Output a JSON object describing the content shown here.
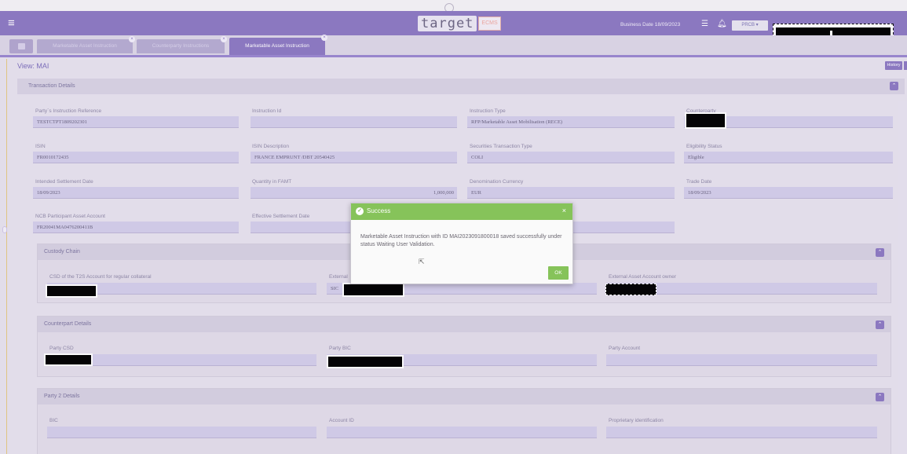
{
  "header": {
    "logo_text": "target",
    "logo_badge": "ECMS",
    "business_date": "Business Date 18/09/2023",
    "user_button": "PRCB ▾",
    "menu_icon": "hamburger-icon",
    "list_icon": "list-icon",
    "bell_icon": "bell-icon"
  },
  "tabs": [
    {
      "label": "Marketable Asset Instruction"
    },
    {
      "label": "Counterparty Instructions"
    },
    {
      "label": "Marketable Asset Instruction"
    }
  ],
  "view": {
    "title": "View: MAI",
    "history_label": "History"
  },
  "transaction": {
    "title": "Transaction Details",
    "fields": {
      "party_ref_label": "Party`s Instruction Reference",
      "party_ref_value": "TESTCTPT1809202301",
      "instr_id_label": "Instruction Id",
      "instr_id_value": "",
      "instr_type_label": "Instruction Type",
      "instr_type_value": "RFP/Marketable Asset Mobilisation (RECE)",
      "counterparty_label": "Counterparty",
      "isin_label": "ISIN",
      "isin_value": "FR0010172435",
      "isin_desc_label": "ISIN Description",
      "isin_desc_value": "FRANCE EMPRUNT /DBT 20540425",
      "sec_tx_type_label": "Securities Transaction Type",
      "sec_tx_type_value": "COLI",
      "eligibility_label": "Eligibility Status",
      "eligibility_value": "Eligible",
      "isd_label": "Intended Settlement Date",
      "isd_value": "18/09/2023",
      "qty_label": "Quantity in FAMT",
      "qty_value": "1,000,000",
      "currency_label": "Denomination Currency",
      "currency_value": "EUR",
      "trade_date_label": "Trade Date",
      "trade_date_value": "18/09/2023",
      "ncb_label": "NCB Participant Asset Account",
      "ncb_value": "FR20041MA0476200411B",
      "esd_label": "Effective Settlement Date"
    }
  },
  "custody": {
    "title": "Custody Chain",
    "csd_label": "CSD of the T2S Account for regular collateral",
    "ext_label": "External",
    "ext_value_prefix": "SIC",
    "owner_label": "External Asset Account owner"
  },
  "counterpart": {
    "title": "Counterpart Details",
    "party_csd_label": "Party CSD",
    "party_bic_label": "Party BIC",
    "party_account_label": "Party Account"
  },
  "party2": {
    "title": "Party 2 Details",
    "bic_label": "BIC",
    "account_id_label": "Account ID",
    "prop_id_label": "Proprietary identification"
  },
  "dialog": {
    "title": "Success",
    "message": "Marketable Asset Instruction with ID MAI2023091800018 saved successfully under status Waiting User Validation.",
    "ok_label": "OK",
    "close": "×"
  },
  "colors": {
    "brand": "#8c79c2",
    "success": "#86c35a"
  }
}
